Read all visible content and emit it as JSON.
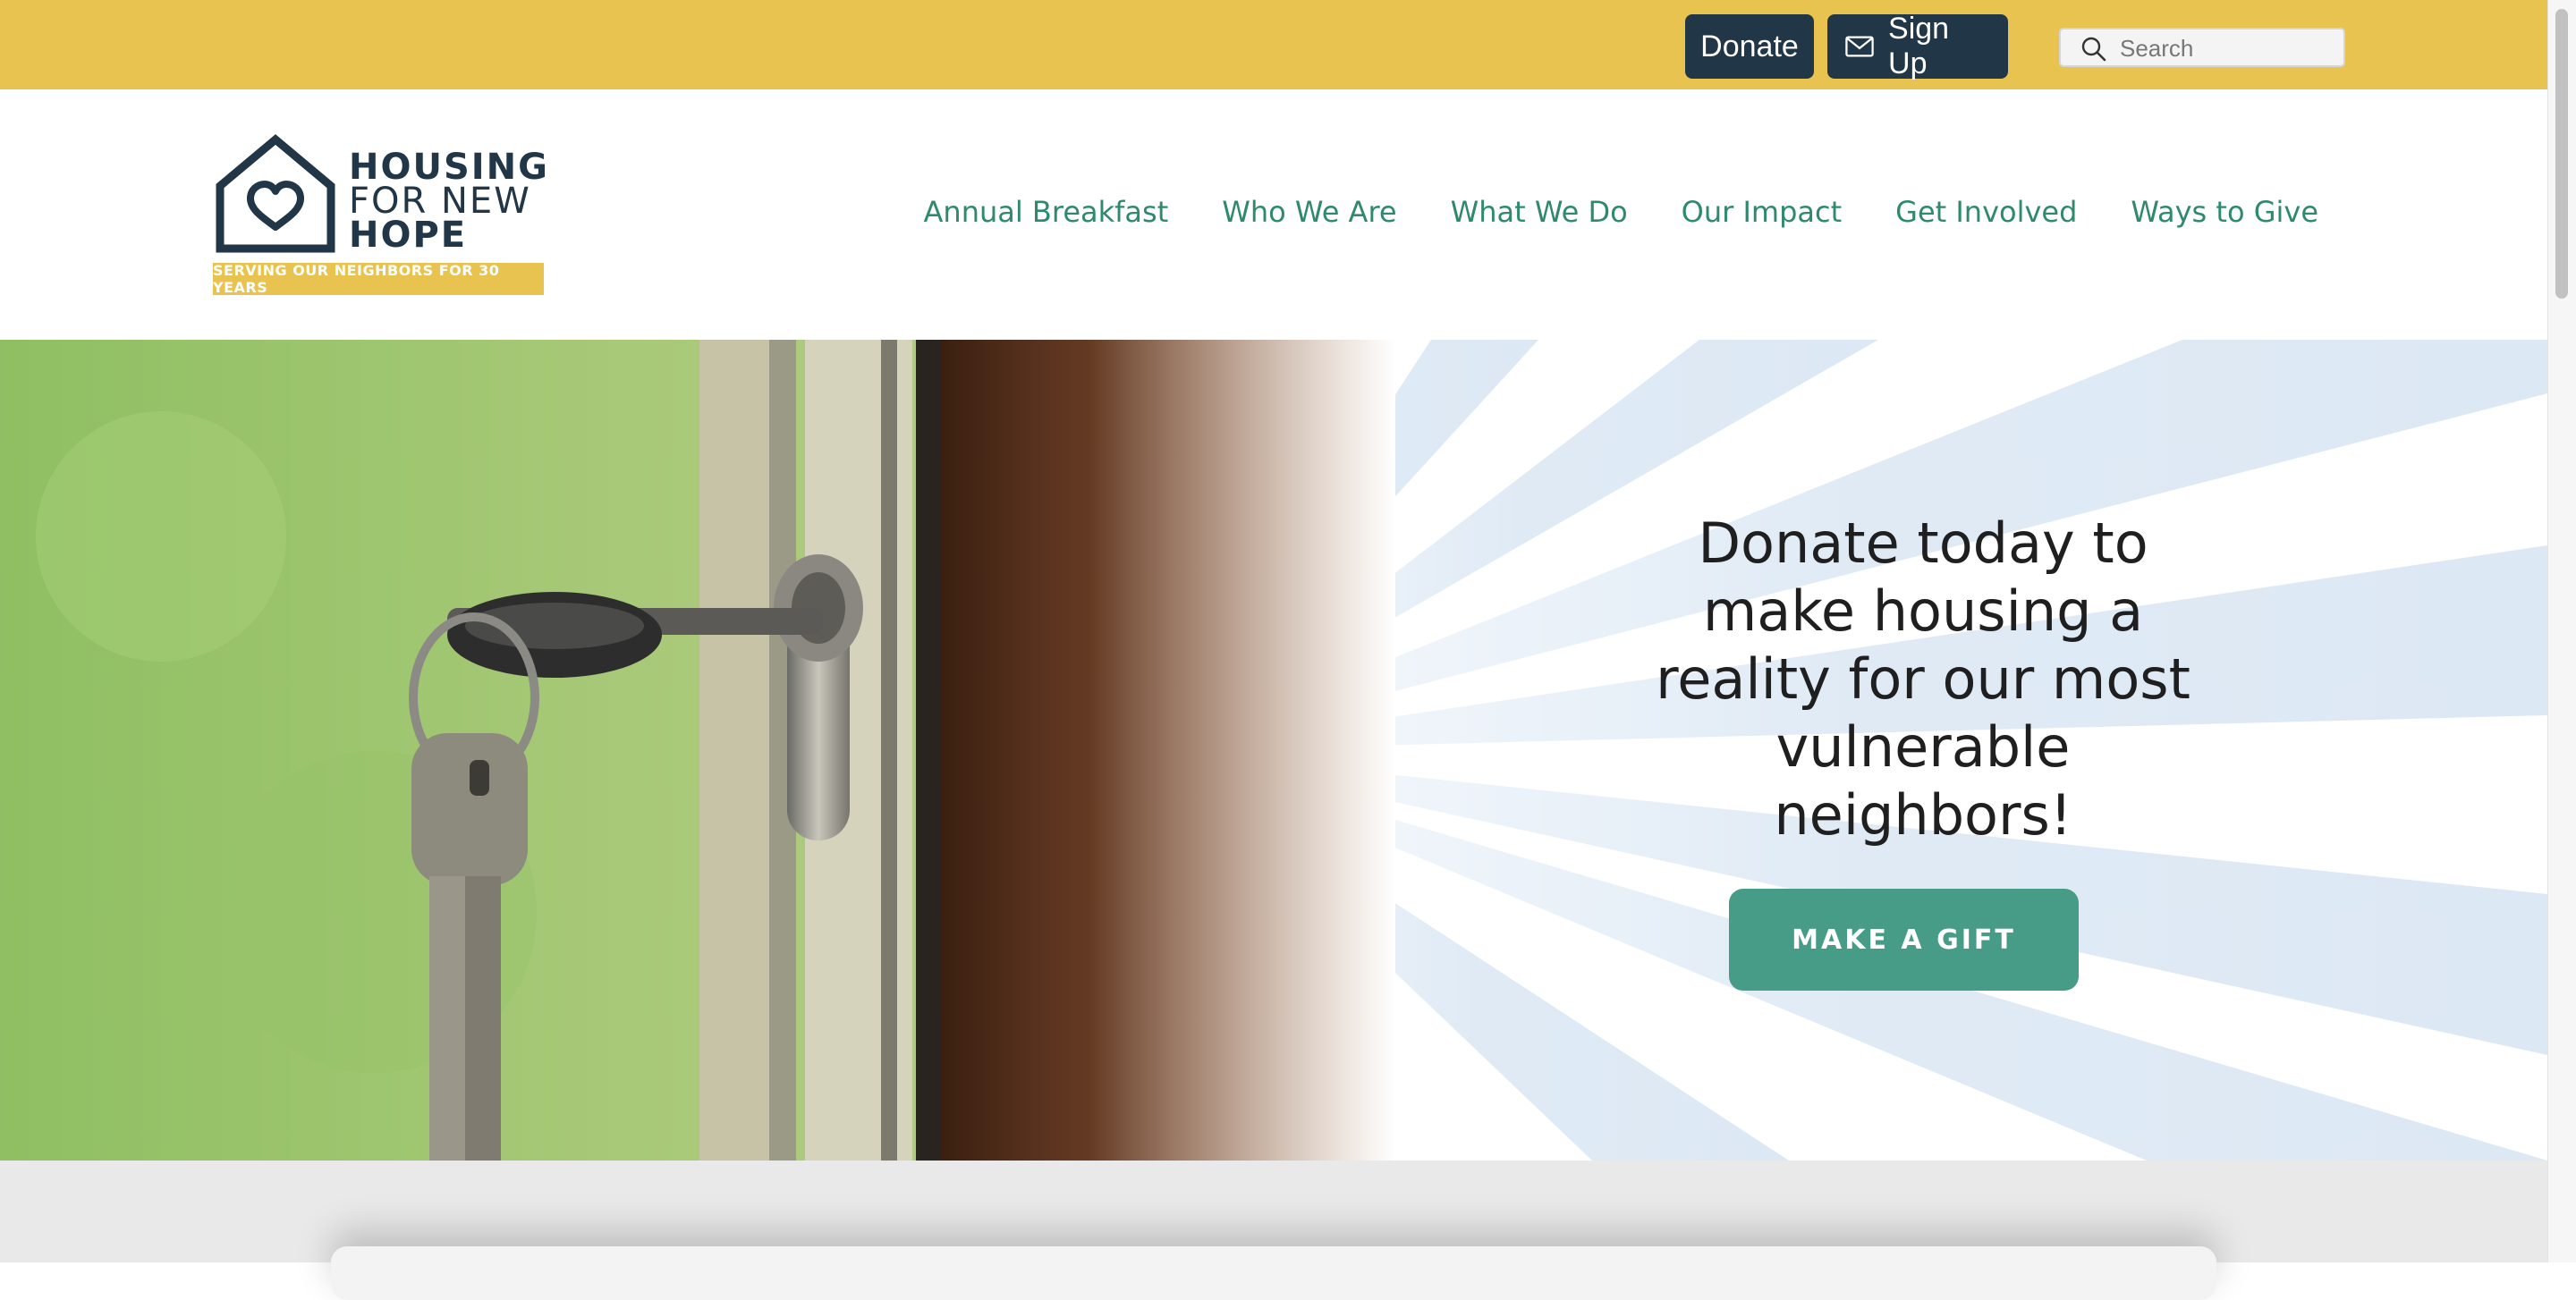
{
  "topbar": {
    "donate_label": "Donate",
    "signup_label": "Sign Up",
    "search_placeholder": "Search",
    "background_color": "#e9c34f",
    "button_color": "#213647"
  },
  "logo": {
    "line1": "HOUSING",
    "line2": "FOR NEW",
    "line3": "HOPE",
    "tagline": "SERVING OUR NEIGHBORS FOR 30 YEARS",
    "icon": "house-heart-icon"
  },
  "nav": {
    "items": [
      {
        "label": "Annual Breakfast"
      },
      {
        "label": "Who We Are"
      },
      {
        "label": "What We Do"
      },
      {
        "label": "Our Impact"
      },
      {
        "label": "Get Involved"
      },
      {
        "label": "Ways to Give"
      }
    ],
    "color": "#2f8a6a"
  },
  "hero": {
    "heading": "Donate today to make housing a reality for our most vulnerable neighbors!",
    "cta_label": "MAKE A GIFT",
    "cta_color": "#469c86",
    "image": "key-in-door-lock-photo"
  }
}
